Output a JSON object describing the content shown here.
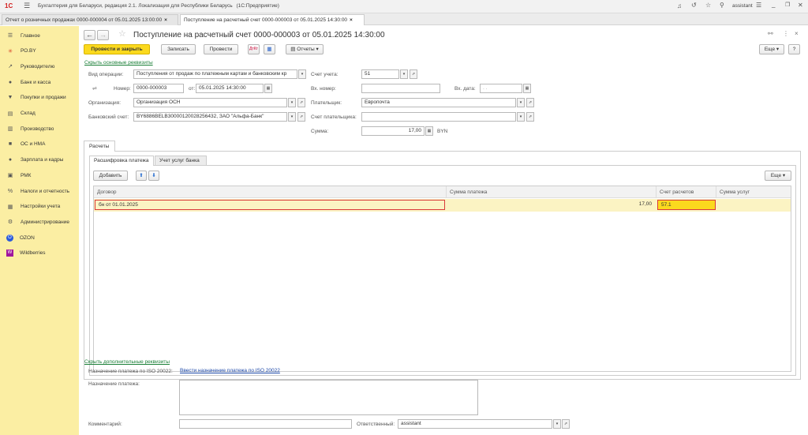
{
  "titlebar": {
    "logo": "1С",
    "title": "Бухгалтерия для Беларуси, редакция 2.1. Локализация для Республики Беларусь",
    "mode": "(1С:Предприятие)",
    "user": "assistant"
  },
  "tabs": [
    {
      "label": "Отчет о розничных продажах 0000-000004 от 05.01.2025 13:00:00"
    },
    {
      "label": "Поступление на расчетный счет 0000-000003 от 05.01.2025 14:30:00"
    }
  ],
  "sidebar": {
    "items": [
      {
        "label": "Главное",
        "icon": "menu-icon",
        "glyph": "☰"
      },
      {
        "label": "РО.BY",
        "icon": "star-burst-icon",
        "glyph": "✳"
      },
      {
        "label": "Руководителю",
        "icon": "trend-icon",
        "glyph": "↗"
      },
      {
        "label": "Банк и касса",
        "icon": "bank-icon",
        "glyph": "●"
      },
      {
        "label": "Покупки и продажи",
        "icon": "cart-icon",
        "glyph": "▼"
      },
      {
        "label": "Склад",
        "icon": "warehouse-icon",
        "glyph": "▤"
      },
      {
        "label": "Производство",
        "icon": "factory-icon",
        "glyph": "▥"
      },
      {
        "label": "ОС и НМА",
        "icon": "truck-icon",
        "glyph": "■"
      },
      {
        "label": "Зарплата и кадры",
        "icon": "person-icon",
        "glyph": "●"
      },
      {
        "label": "РМК",
        "icon": "register-icon",
        "glyph": "▣"
      },
      {
        "label": "Налоги и отчетность",
        "icon": "percent-icon",
        "glyph": "%"
      },
      {
        "label": "Настройки учета",
        "icon": "settings-doc-icon",
        "glyph": "▦"
      },
      {
        "label": "Администрирование",
        "icon": "gear-icon",
        "glyph": "⚙"
      },
      {
        "label": "OZON",
        "icon": "ozon-icon",
        "glyph": "O"
      },
      {
        "label": "Wildberries",
        "icon": "wildberries-icon",
        "glyph": "W"
      }
    ]
  },
  "doc": {
    "title": "Поступление на расчетный счет 0000-000003 от 05.01.2025 14:30:00",
    "buttons": {
      "post_close": "Провести и закрыть",
      "save": "Записать",
      "post": "Провести",
      "reports": "Отчеты",
      "more": "Еще",
      "help": "?"
    },
    "hide_main_link": "Скрыть основные реквизиты",
    "fields": {
      "op_type_label": "Вид операции:",
      "op_type_value": "Поступления от продаж по платежным картам и банковским кр",
      "number_label": "Номер:",
      "number_value": "0000-000003",
      "from_label": "от:",
      "date_value": "05.01.2025 14:30:00",
      "org_label": "Организация:",
      "org_value": "Организация ОСН",
      "bank_acc_label": "Банковский счет:",
      "bank_acc_value": "BY6886BELB30000120028256432, ЗАО \"Альфа-Банк\"",
      "account_label": "Счет учета:",
      "account_value": "51",
      "in_number_label": "Вх. номер:",
      "in_number_value": "",
      "in_date_label": "Вх. дата:",
      "in_date_value": ". .",
      "payer_label": "Плательщик:",
      "payer_value": "Европочта",
      "payer_acc_label": "Счет плательщика:",
      "payer_acc_value": "",
      "sum_label": "Сумма:",
      "sum_value": "17,00",
      "currency": "BYN"
    },
    "section_tab": "Расчеты",
    "subtabs": [
      {
        "label": "Расшифровка платежа"
      },
      {
        "label": "Учет услуг банка"
      }
    ],
    "table": {
      "add_button": "Добавить",
      "more_button": "Еще",
      "columns": [
        "Договор",
        "Сумма платежа",
        "Счет расчетов",
        "Сумма услуг"
      ],
      "rows": [
        {
          "contract": "бн от 01.01.2025",
          "amount": "17,00",
          "account": "57.1",
          "services": ""
        }
      ]
    },
    "hide_extra_link": "Скрыть дополнительные реквизиты",
    "iso_label": "Назначение платежа по ISO 20022:",
    "iso_link": "Ввести назначение платежа по ISO 20022",
    "purpose_label": "Назначение платежа:",
    "comment_label": "Комментарий:",
    "responsible_label": "Ответственный:",
    "responsible_value": "assistant"
  },
  "colors": {
    "sidebar_bg": "#fbeea3",
    "primary_button": "#fbd91e",
    "selected_row": "#fbf3c3",
    "highlight_border": "#d93a3a",
    "link_green": "#1a7f37"
  }
}
